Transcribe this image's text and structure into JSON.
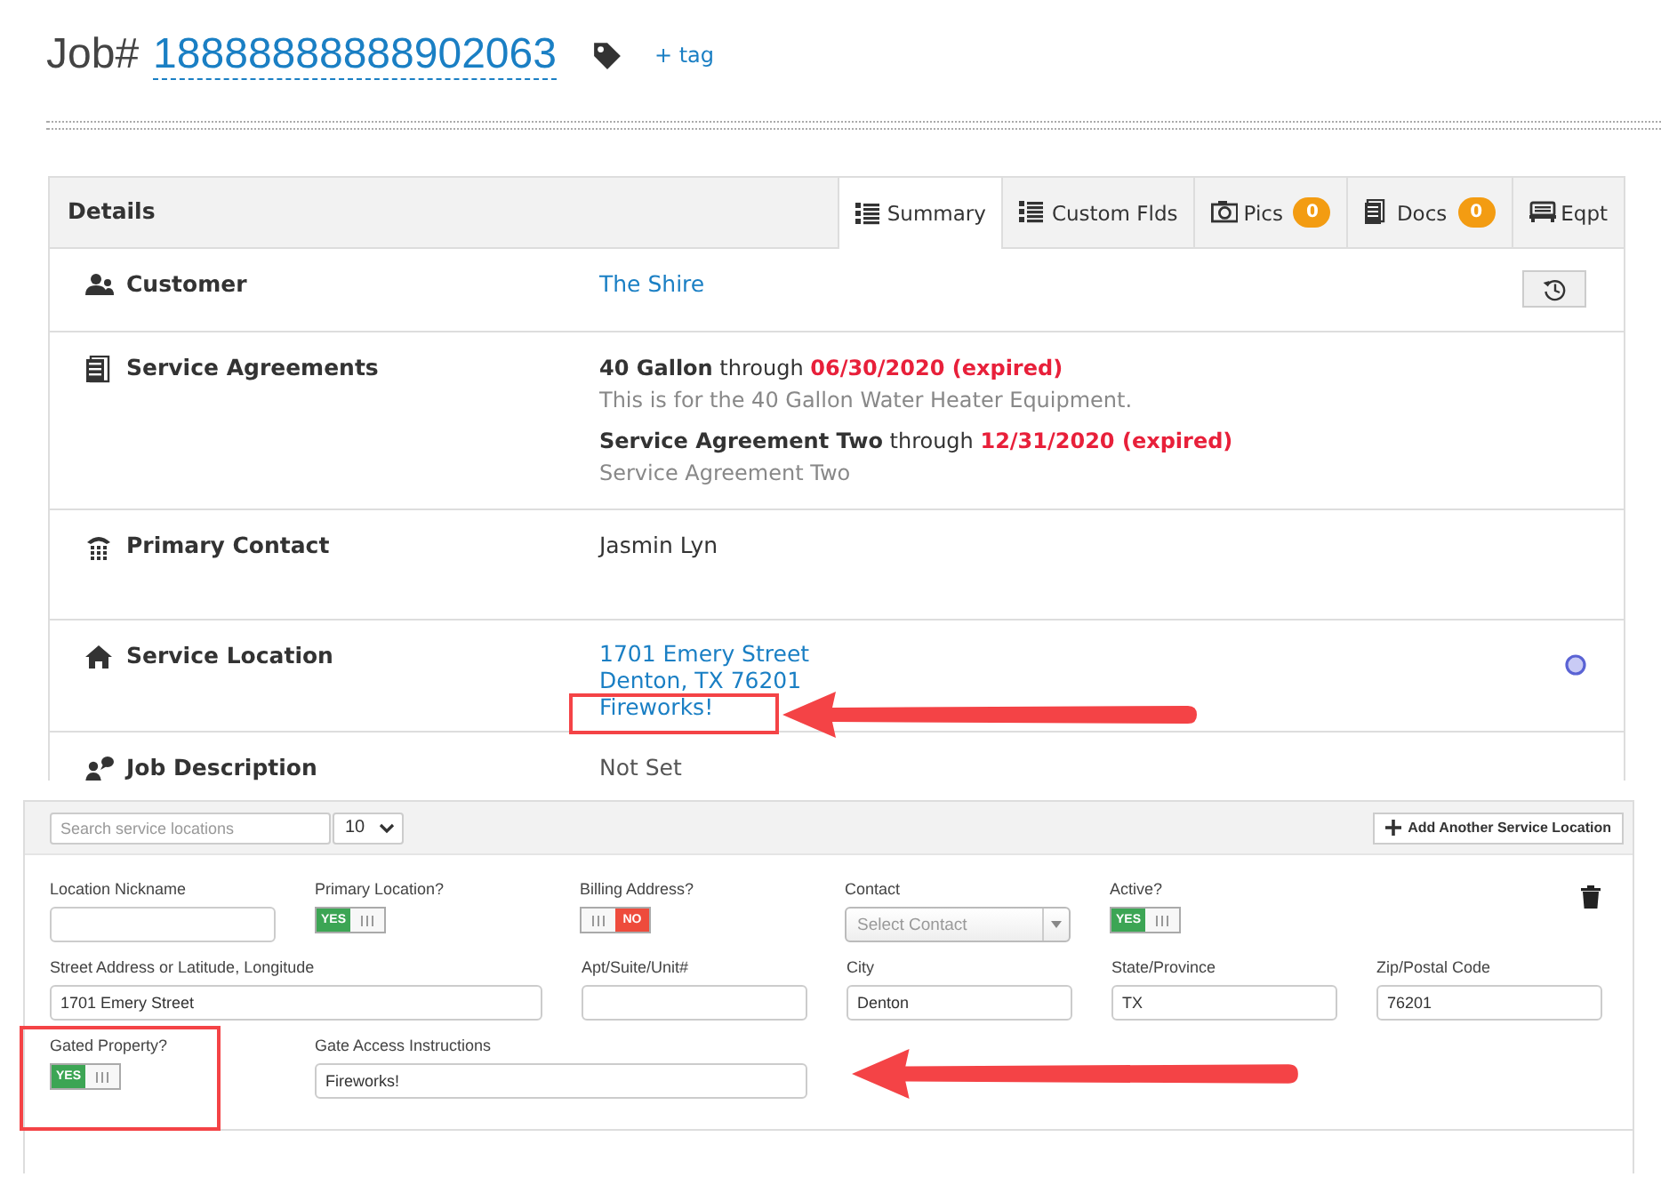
{
  "job": {
    "label": "Job#",
    "number": "18888888888902063",
    "add_tag": "+ tag"
  },
  "details": {
    "title": "Details",
    "tabs": [
      {
        "label": "Summary",
        "selected": true
      },
      {
        "label": "Custom Flds",
        "selected": false
      },
      {
        "label": "Pics",
        "selected": false,
        "badge": "0"
      },
      {
        "label": "Docs",
        "selected": false,
        "badge": "0"
      },
      {
        "label": "Eqpt",
        "selected": false
      }
    ],
    "rows": [
      {
        "kind": "customer",
        "label": "Customer",
        "value": "The Shire"
      },
      {
        "kind": "agreements",
        "label": "Service Agreements",
        "agreements": [
          {
            "name": "40 Gallon",
            "through": "through",
            "date": "06/30/2020",
            "status": "(expired)",
            "description": "This is for the 40 Gallon Water Heater Equipment."
          },
          {
            "name": "Service Agreement Two",
            "through": "through",
            "date": "12/31/2020",
            "status": "(expired)",
            "description": "Service Agreement Two"
          }
        ]
      },
      {
        "kind": "contact",
        "label": "Primary Contact",
        "value": "Jasmin Lyn"
      },
      {
        "kind": "location",
        "label": "Service Location",
        "lines": [
          "1701 Emery Street",
          "Denton, TX 76201",
          "Fireworks!"
        ]
      },
      {
        "kind": "description",
        "label": "Job Description",
        "value": "Not Set"
      }
    ]
  },
  "locations": {
    "search": {
      "placeholder": "Search service locations"
    },
    "page_size": "10",
    "add_button": "Add Another Service Location",
    "form": [
      [
        {
          "kind": "text",
          "label": "Location Nickname"
        },
        {
          "kind": "toggle",
          "label": "Primary Location?",
          "on": true,
          "text": "YES"
        },
        {
          "kind": "toggle",
          "label": "Billing Address?",
          "on": false,
          "text": "NO"
        },
        {
          "kind": "select",
          "label": "Contact",
          "placeholder": "Select Contact"
        },
        {
          "kind": "toggle",
          "label": "Active?",
          "on": true,
          "text": "YES"
        }
      ],
      [
        {
          "kind": "long-text",
          "label": "Street Address or Latitude, Longitude",
          "value": "1701 Emery Street"
        },
        {
          "kind": "text",
          "label": "Apt/Suite/Unit#"
        },
        {
          "kind": "text",
          "label": "City",
          "value": "Denton"
        },
        {
          "kind": "text",
          "label": "State/Province",
          "value": "TX"
        },
        {
          "kind": "text",
          "label": "Zip/Postal Code",
          "value": "76201"
        }
      ],
      [
        {
          "kind": "toggle",
          "label": "Gated Property?",
          "on": true,
          "text": "YES"
        },
        {
          "kind": "long-text",
          "label": "Gate Access Instructions",
          "value": "Fireworks!"
        }
      ]
    ]
  }
}
